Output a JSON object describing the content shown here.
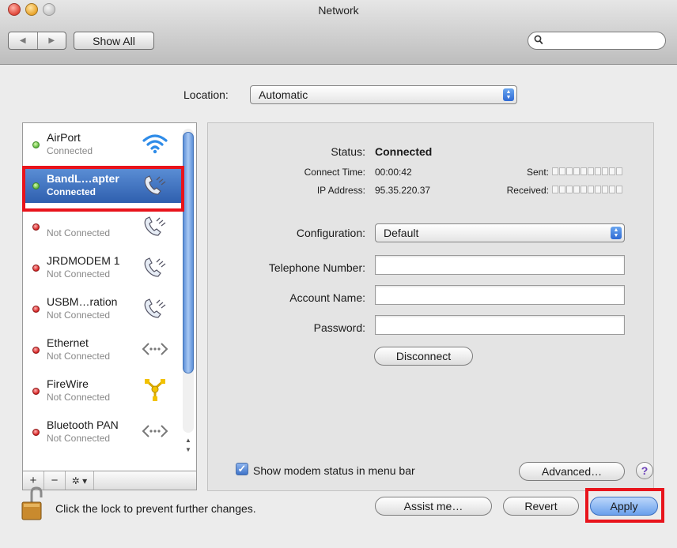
{
  "window": {
    "title": "Network"
  },
  "toolbar": {
    "back": "◀",
    "forward": "▶",
    "show_all": "Show All",
    "search_placeholder": ""
  },
  "location": {
    "label": "Location:",
    "value": "Automatic"
  },
  "services": [
    {
      "name": "AirPort",
      "status": "Connected",
      "state": "green",
      "icon": "wifi-icon"
    },
    {
      "name": "BandL…apter",
      "status": "Connected",
      "state": "green",
      "icon": "phone-modem-icon",
      "selected": true
    },
    {
      "name": "",
      "status": "Not Connected",
      "state": "red",
      "icon": "phone-modem-icon"
    },
    {
      "name": "JRDMODEM 1",
      "status": "Not Connected",
      "state": "red",
      "icon": "phone-modem-icon"
    },
    {
      "name": "USBM…ration",
      "status": "Not Connected",
      "state": "red",
      "icon": "phone-modem-icon"
    },
    {
      "name": "Ethernet",
      "status": "Not Connected",
      "state": "red",
      "icon": "ethernet-icon"
    },
    {
      "name": "FireWire",
      "status": "Not Connected",
      "state": "red",
      "icon": "firewire-icon"
    },
    {
      "name": "Bluetooth PAN",
      "status": "Not Connected",
      "state": "red",
      "icon": "ethernet-icon"
    }
  ],
  "list_toolbar": {
    "add": "+",
    "remove": "−",
    "gear": "✲ ▾"
  },
  "detail": {
    "status_label": "Status:",
    "status_value": "Connected",
    "connect_time_label": "Connect Time:",
    "connect_time_value": "00:00:42",
    "ip_label": "IP Address:",
    "ip_value": "95.35.220.37",
    "sent_label": "Sent:",
    "received_label": "Received:",
    "configuration_label": "Configuration:",
    "configuration_value": "Default",
    "telephone_label": "Telephone Number:",
    "telephone_value": "",
    "account_label": "Account Name:",
    "account_value": "",
    "password_label": "Password:",
    "password_value": "",
    "disconnect": "Disconnect",
    "show_modem_status": "Show modem status in menu bar",
    "advanced": "Advanced…",
    "help": "?"
  },
  "footer": {
    "lock_text": "Click the lock to prevent further changes.",
    "assist": "Assist me…",
    "revert": "Revert",
    "apply": "Apply"
  },
  "colors": {
    "highlight": "#e8141c",
    "selection": "#3b6dc0"
  }
}
